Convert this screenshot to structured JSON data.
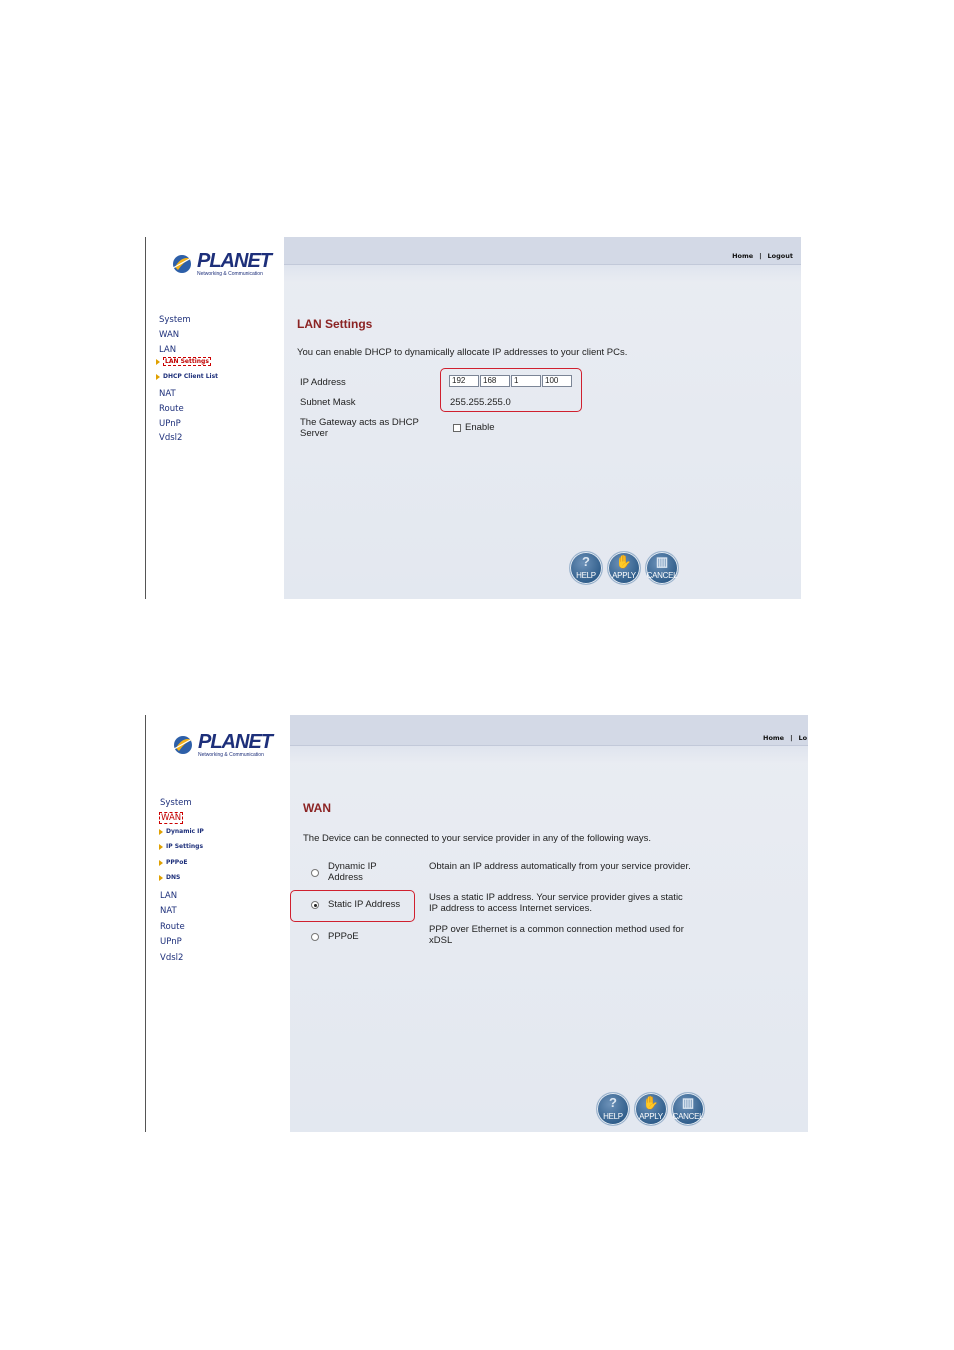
{
  "brand": {
    "name": "PLANET",
    "tagline": "Networking & Communication"
  },
  "colors": {
    "accent_title": "#8b2323",
    "nav_link": "#1d2f7a",
    "highlight_box": "#d0202f"
  },
  "toplinks": {
    "home": "Home",
    "separator": "|",
    "logout": "Logout",
    "logout_truncated": "Lo"
  },
  "buttons": {
    "help": "HELP",
    "apply": "APPLY",
    "cancel": "CANCEL",
    "help_icon": "question-mark-icon",
    "apply_icon": "hand-icon",
    "cancel_icon": "trash-can-icon"
  },
  "lan_screen": {
    "nav": {
      "system": "System",
      "wan": "WAN",
      "lan": "LAN",
      "lan_settings": "LAN Settings",
      "dhcp_client_list": "DHCP Client List",
      "nat": "NAT",
      "route": "Route",
      "upnp": "UPnP",
      "vdsl2": "Vdsl2"
    },
    "title": "LAN Settings",
    "description": "You can enable DHCP to dynamically allocate IP addresses to your client PCs.",
    "ip_label": "IP Address",
    "ip": [
      "192",
      "168",
      "1",
      "100"
    ],
    "mask_label": "Subnet Mask",
    "mask_value": "255.255.255.0",
    "dhcp_label": "The Gateway acts as DHCP Server",
    "dhcp_option": "Enable",
    "dhcp_enabled": false
  },
  "wan_screen": {
    "nav": {
      "system": "System",
      "wan": "WAN",
      "dynamic_ip": "Dynamic IP",
      "ip_settings": "IP Settings",
      "pppoe": "PPPoE",
      "dns": "DNS",
      "lan": "LAN",
      "nat": "NAT",
      "route": "Route",
      "upnp": "UPnP",
      "vdsl2": "Vdsl2"
    },
    "title": "WAN",
    "description": "The Device can be connected to your service provider in any of the following ways.",
    "options": [
      {
        "label": "Dynamic IP Address",
        "desc": "Obtain an IP address automatically from your service provider.",
        "selected": false
      },
      {
        "label": "Static IP Address",
        "desc": "Uses a static IP address. Your service provider gives a static IP address to access Internet services.",
        "selected": true
      },
      {
        "label": "PPPoE",
        "desc": "PPP over Ethernet is a common connection method used for xDSL",
        "selected": false
      }
    ]
  }
}
